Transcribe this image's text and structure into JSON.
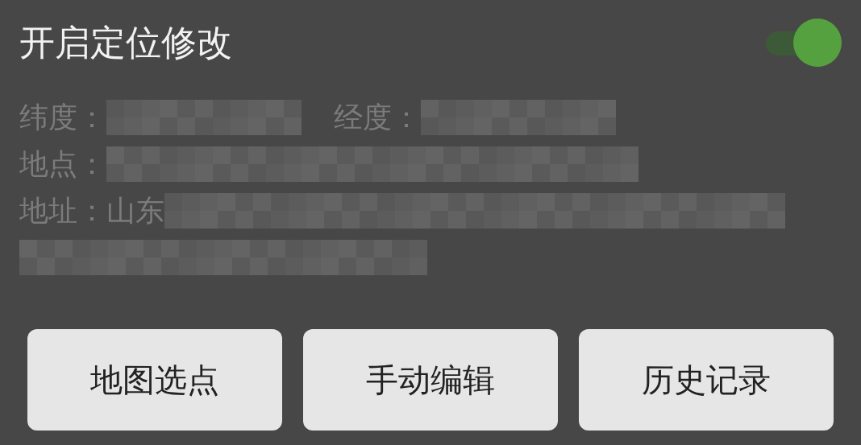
{
  "header": {
    "title": "开启定位修改",
    "toggle": {
      "on": true
    }
  },
  "info": [
    {
      "fields": [
        {
          "label": "纬度：",
          "redacted": true
        },
        {
          "label": "经度：",
          "redacted": true
        }
      ]
    },
    {
      "fields": [
        {
          "label": "地点：",
          "redacted": true
        }
      ]
    },
    {
      "fields": [
        {
          "label": "地址：",
          "value": "山东",
          "redacted": true
        }
      ]
    }
  ],
  "buttons": [
    "地图选点",
    "手动编辑",
    "历史记录"
  ]
}
